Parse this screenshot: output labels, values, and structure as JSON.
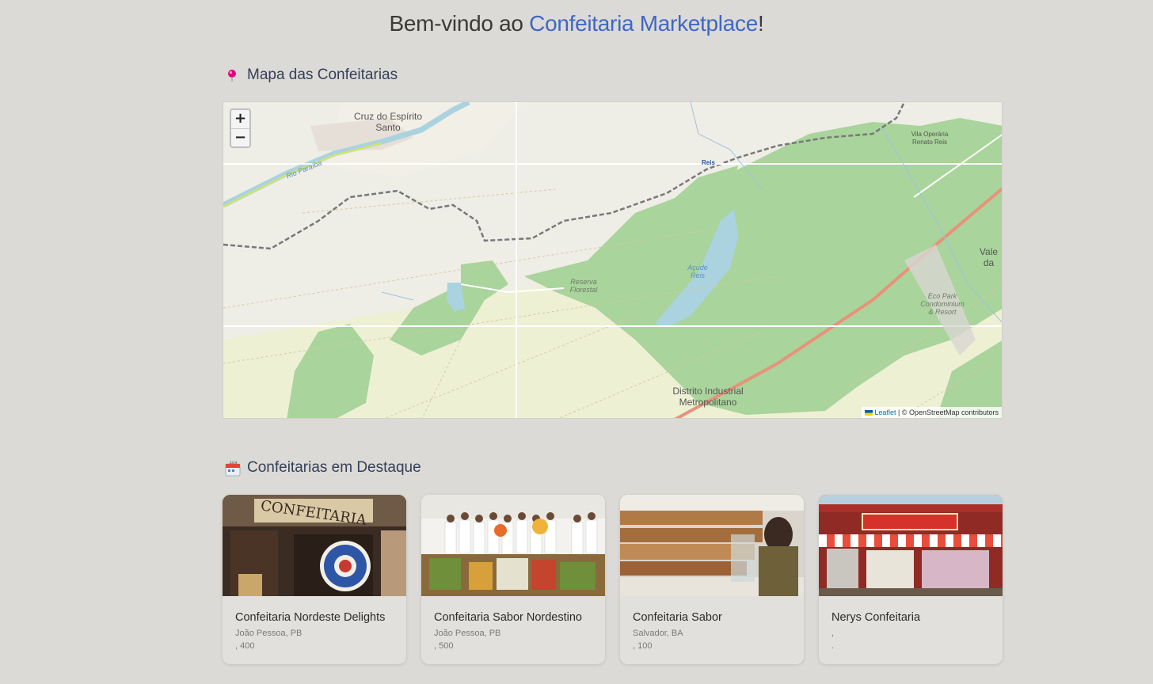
{
  "header": {
    "title_prefix": "Bem-vindo ao ",
    "title_brand": "Confeitaria Marketplace",
    "title_suffix": "!"
  },
  "map_section": {
    "heading": "Mapa das Confeitarias",
    "icon": "pin-icon"
  },
  "map": {
    "zoom_in": "+",
    "zoom_out": "−",
    "labels": {
      "town": "Cruz do Espírito Santo",
      "river": "Rio Paraíba",
      "vila": "Vila Operária Renato Reis",
      "reis": "Reis",
      "reserva": "Reserva Florestal",
      "acude": "Açude Reis",
      "distrito": "Distrito Industrial Metropolitano",
      "eco": "Eco Park Condominium & Resort",
      "vale": "Vale da"
    },
    "attribution": {
      "leaflet": "Leaflet",
      "separator": " | © ",
      "osm": "OpenStreetMap contributors"
    }
  },
  "featured_section": {
    "heading": "Confeitarias em Destaque",
    "icon": "calendar-24h-icon"
  },
  "cards": [
    {
      "name": "Confeitaria Nordeste Delights",
      "city": "João Pessoa, PB",
      "meta": ", 400",
      "photo": "confeitaria-colombo-photo"
    },
    {
      "name": "Confeitaria Sabor Nordestino",
      "city": "João Pessoa, PB",
      "meta": ", 500",
      "photo": "festa-junina-table-photo"
    },
    {
      "name": "Confeitaria Sabor",
      "city": "Salvador, BA",
      "meta": ", 100",
      "photo": "bakery-counter-photo"
    },
    {
      "name": "Nerys Confeitaria",
      "city": ",",
      "meta": ".",
      "photo": "bake-shop-storefront-photo"
    }
  ],
  "colors": {
    "brand": "#3f67c4",
    "page_bg": "#dcdad6",
    "forest": "#a8d49a",
    "water": "#aad3df",
    "rail": "#777777",
    "highway": "#e8927c"
  }
}
